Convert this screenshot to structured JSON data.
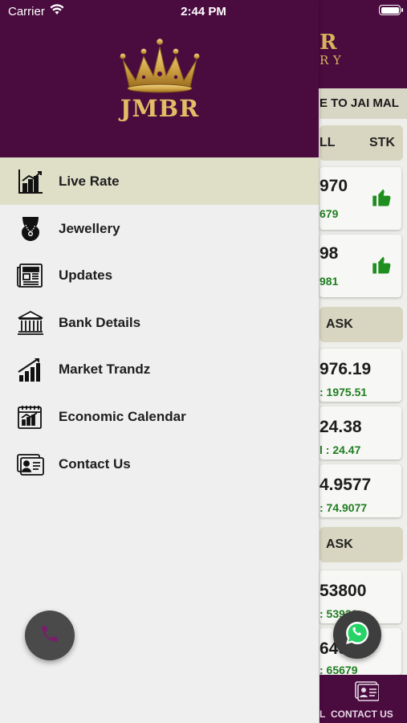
{
  "status_bar": {
    "carrier": "Carrier",
    "time": "2:44 PM"
  },
  "drawer": {
    "logo_text": "JMBR",
    "menu": [
      {
        "label": "Live Rate",
        "icon": "chart-icon",
        "active": true
      },
      {
        "label": "Jewellery",
        "icon": "necklace-icon",
        "active": false
      },
      {
        "label": "Updates",
        "icon": "newspaper-icon",
        "active": false
      },
      {
        "label": "Bank Details",
        "icon": "bank-icon",
        "active": false
      },
      {
        "label": "Market Trandz",
        "icon": "trend-icon",
        "active": false
      },
      {
        "label": "Economic Calendar",
        "icon": "calendar-icon",
        "active": false
      },
      {
        "label": "Contact Us",
        "icon": "contact-card-icon",
        "active": false
      }
    ]
  },
  "background": {
    "logo_line1": "R",
    "logo_line2": "RY",
    "marquee": "E TO JAI MAL",
    "col_sell": "LL",
    "col_stk": "STK",
    "rows1": [
      {
        "big": "970",
        "small": "679"
      },
      {
        "big": "98",
        "small": "981"
      }
    ],
    "ask_header_1": "ASK",
    "rows2": [
      {
        "big": "976.19",
        "small": ": 1975.51"
      },
      {
        "big": "24.38",
        "small": "l : 24.47"
      },
      {
        "big": "4.9577",
        "small": ": 74.9077"
      }
    ],
    "ask_header_2": "ASK",
    "rows3": [
      {
        "big": "53800",
        "small": ": 53920"
      },
      {
        "big": "6497",
        "small": ": 65679"
      }
    ],
    "bottom_left_label": "L",
    "bottom_label": "CONTACT US"
  },
  "colors": {
    "primary": "#4a0b3f",
    "gold": "#e2bd66",
    "active_row": "#dfdfc8",
    "green": "#1f7d1f"
  }
}
